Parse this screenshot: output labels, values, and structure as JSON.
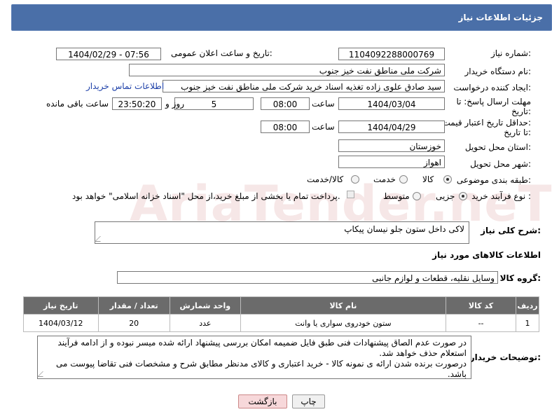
{
  "header": {
    "title": "جزئیات اطلاعات نیاز"
  },
  "watermark": "AriaTender.neT",
  "fields": {
    "need_number_label": "شماره نیاز:",
    "need_number": "1104092288000769",
    "announce_label": "تاریخ و ساعت اعلان عمومی:",
    "announce_value": "1404/02/29 - 07:56",
    "buyer_label": "نام دستگاه خریدار:",
    "buyer_value": "شرکت ملی مناطق نفت خیز جنوب",
    "creator_label": "ایجاد کننده درخواست:",
    "creator_value": "سید صادق علوی زاده  تغذیه اسناد خرید  شرکت ملی مناطق نفت خیز جنوب",
    "contact_link": "اطلاعات تماس خریدار",
    "reply_label_1": "مهلت ارسال پاسخ: تا",
    "reply_label_2": "تاریخ:",
    "reply_date": "1404/03/04",
    "time_label": "ساعت",
    "reply_time": "08:00",
    "days_value": "5",
    "days_label": "روز و",
    "remaining_time": "23:50:20",
    "remaining_label": "ساعت باقی مانده",
    "price_label_1": "حداقل تاریخ اعتبار قیمت:",
    "price_label_2": "تا تاریخ:",
    "price_date": "1404/04/29",
    "price_time": "08:00",
    "province_label": "استان محل تحویل:",
    "province_value": "خوزستان",
    "city_label": "شهر محل تحویل:",
    "city_value": "اهواز",
    "category_label": "طبقه بندی موضوعی:",
    "category_options": [
      "کالا",
      "خدمت",
      "کالا/خدمت"
    ],
    "process_label": "نوع فرآیند خرید :",
    "process_options": [
      "جزیی",
      "متوسط"
    ],
    "payment_note": "پرداخت تمام یا بخشی از مبلغ خرید،از محل \"اسناد خزانه اسلامی\" خواهد بود."
  },
  "description": {
    "label": "شرح کلی نیاز:",
    "value": "لاکی داخل ستون جلو نیسان پیکاپ"
  },
  "goods_section": {
    "title": "اطلاعات کالاهای مورد نیاز",
    "group_label": "گروه کالا:",
    "group_value": "وسایل نقلیه، قطعات و لوازم جانبی"
  },
  "table": {
    "headers": [
      "ردیف",
      "کد کالا",
      "نام کالا",
      "واحد شمارش",
      "تعداد / مقدار",
      "تاریخ نیاز"
    ],
    "rows": [
      [
        "1",
        "--",
        "ستون خودروی سواری یا وانت",
        "عدد",
        "20",
        "1404/03/12"
      ]
    ]
  },
  "buyer_notes": {
    "label": "توضیحات خریدار:",
    "value": "در صورت عدم الصاق پیشنهادات فنی طبق فایل ضمیمه امکان بررسی پیشنهاد ارائه شده میسر نبوده و از ادامه فرآیند استعلام حذف خواهد شد.\nدرصورت برنده شدن ارائه ی نمونه کالا - خرید اعتباری و کالای مدنظر مطابق شرح و مشخصات فنی تقاضا پیوست می باشد."
  },
  "buttons": {
    "print": "چاپ",
    "back": "بازگشت"
  }
}
